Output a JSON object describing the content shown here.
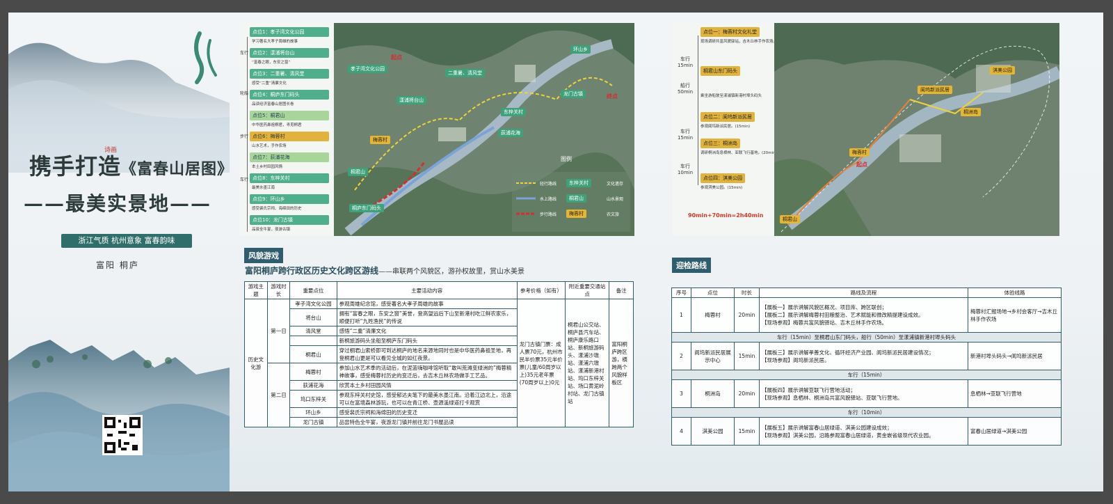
{
  "left": {
    "title_a": "携手打造",
    "title_b": "《富春山居图》",
    "poet_tag": "诗画",
    "title_line2": "——最美实景地——",
    "slogan": "浙江气质  杭州意象  富春韵味",
    "location": "富阳  桐庐"
  },
  "map1": {
    "points": [
      {
        "label": "点位1：孝子湾文化公园",
        "desc": "学习著名大孝子周雄的故事",
        "style": "green"
      },
      {
        "label": "点位2：漾浦将台山",
        "desc": "“富春之眼，东安之窗”",
        "style": "green"
      },
      {
        "label": "点位3：二重暑、清风堂",
        "desc": "感受“二重”清廉文化",
        "style": "green"
      },
      {
        "label": "点位4：桐庐东门码头",
        "desc": "品读经济富春山居图长卷",
        "style": "green"
      },
      {
        "label": "点位5：桐君山",
        "desc": "中华医药鼻祖桐君，寻觅桐君",
        "style": "light"
      },
      {
        "label": "点位6：梅蓉村",
        "desc": "山水艺术，手作农场",
        "style": "yellow"
      },
      {
        "label": "点位7：荻浦花海",
        "desc": "本土乡村田园风情",
        "style": "light"
      },
      {
        "label": "点位8：东梓关村",
        "desc": "最美水墨江南",
        "style": "green"
      },
      {
        "label": "点位9：环山乡",
        "desc": "感受裴氏宗祠、海绵田的历史",
        "style": "green"
      },
      {
        "label": "点位10：龙门古镇",
        "desc": "品尝全牛宴，夜游古镇",
        "style": "green"
      }
    ],
    "modes": [
      "车行",
      "轮船",
      "步行",
      "车行"
    ],
    "map_labels": {
      "start": "起点",
      "end": "终点",
      "legend": "图例",
      "l1": "孝子湾文化公园",
      "l2": "二重暑、清风堂",
      "l3": "环山乡",
      "l4": "漾浦将台山",
      "l5": "龙门古镇",
      "l6": "东梓关村",
      "l7": "荻浦花海",
      "l8": "梅蓉村",
      "l9": "桐君山",
      "l10": "桐庐东门码头"
    },
    "legend": [
      {
        "line": "轻行路线",
        "tag": "东梓关村",
        "tag_desc": "文化遗存"
      },
      {
        "line": "水上路线",
        "tag": "桐君山",
        "tag_desc": "山水景观"
      },
      {
        "line": "步行路线",
        "tag": "梅蓉村",
        "tag_desc": "农文旅"
      }
    ]
  },
  "map2": {
    "points": [
      {
        "mode": "",
        "label": "点位一：梅蓉村文化礼堂",
        "desc": "现场调研共富风貌驿站，吉木丘林手作农场。(20min)"
      },
      {
        "mode": "车行15min",
        "label": "桐君山东门码头",
        "desc": ""
      },
      {
        "mode": "船行50min",
        "label": "",
        "desc": "乘坐游船驶至漾浦镇新港村埠头码头"
      },
      {
        "mode": "",
        "label": "点位二：阆坞新派民居",
        "desc": "参观阆坞新派民居。(15min)"
      },
      {
        "mode": "车行15min",
        "label": "点位三：桐洲岛",
        "desc": "调研桐洲岛息栖林、亚联飞行基地。(20min)"
      },
      {
        "mode": "车行10min",
        "label": "点位四：淇美公园",
        "desc": "参观淇美公园。(15min)"
      }
    ],
    "total": "90min+70min=2h40min",
    "map_labels": {
      "l1": "淇美公园",
      "l2": "阆坞新派民居",
      "l3": "桐洲岛",
      "l4": "梅蓉村",
      "l5": "桐君山",
      "start": "起点"
    }
  },
  "section1": {
    "tag": "风貌游戏",
    "subtitle": "富阳桐庐跨行政区历史文化跨区游线",
    "subtitle_tail": "——串联两个风貌区，游孙权故里，赏山水美景",
    "headers": [
      "游戏主题",
      "游戏时长",
      "重要点位",
      "主要活动内容",
      "参考价格（如有）",
      "附近重要交通站点",
      "备注"
    ],
    "theme": "历史文化游",
    "day1": "第一日",
    "day2": "第二日",
    "rows": [
      {
        "point": "孝子湾文化公园",
        "activity": "参观周雄纪念馆，感受著名大孝子周雄的故事"
      },
      {
        "point": "将台山",
        "activity": "拥有“富春之眼，东安之窗”美誉，登高望远后下山至新港村吃江鲜农家乐，顺便打听“九姓渔民”的传说"
      },
      {
        "point": "清风堂",
        "activity": "感悟“二重”清廉文化"
      },
      {
        "point": "",
        "activity": "新桐旅游码头坐船至桐庐东门码头"
      },
      {
        "point": "桐君山",
        "activity": "穿过桐君山索桥即可到达桐庐的地名来源地同时也是中华医药鼻祖圣地，再登桐君山更是可以看见全城的如红夜景。"
      },
      {
        "point": "梅蓉村",
        "activity": "参加山水艺术季的活动后，在泥蓝嗨咖啡馆听取“敢叫荒滩变绿洲的”梅蓉精神故事，感受梅蓉村历史的变迁后，去吉木丘林农场做手工艺品。"
      },
      {
        "point": "荻浦花海",
        "activity": "欣赏本土乡村田园风情"
      },
      {
        "point": "坞口东梓关",
        "activity": "参观东梓关村史馆，感受郁达夫笔下的最美水墨江南。沿着江边北上，沿途可以在富境森林游玩，也可以在青江桥、壶源溪绿道打卡观赏"
      },
      {
        "point": "环山乡",
        "activity": "感受裴氏宗祠和海绵田的历史变迁"
      },
      {
        "point": "龙门古镇",
        "activity": "品尝特色全牛宴，夜游龙门镇并前往龙门书屋品读"
      }
    ],
    "price": "龙门古镇门票：成人票70元，杭州市民半价票35元半价票(儿童/60周岁以上)35元老年票(70周岁以上)0元",
    "stations": "桐君山公交站、桐庐县汽车站、桐庐康乐路口站、新桐旅游码头、漾浦沙墩站、漾浦六墩站、漾浦新港村站、坞口东梓关站、场口黄泥岭村站、龙门古镇站",
    "note": "富阳桐庐跨区游，横跨两个风貌样板区"
  },
  "section2": {
    "tag": "迎检路线",
    "headers": [
      "序号",
      "点位",
      "时长",
      "路线及流程",
      "体验线路"
    ],
    "rows": [
      {
        "no": "1",
        "point": "梅蓉村",
        "dur": "20min",
        "flow": "【展板一】展示讲解风貌区概况、项目库、跨区联创；\n【展板二】展示讲解梅蓉村田粮整治、艺术赋能和微改精提建设成效。\n【现场参观】梅蓉共富风貌驿站、吉木丘林手作农场。",
        "exp": "梅蓉村汇报场地→乡村会客厅→吉木丘林手作农场"
      },
      {
        "no": "2",
        "point": "阆坞新派民居展示中心",
        "dur": "15min",
        "flow": "【展板三】展示讲解孝善文化、循环经济产业园、阆坞新派民居建设情况；\n【现场参观】阆坞新派民居。",
        "exp": "新港村埠头码头→阆坞新派民居"
      },
      {
        "no": "3",
        "point": "桐洲岛",
        "dur": "20min",
        "flow": "【展板四】展示讲解亚联飞行营地活动；\n【现场参观】息栖林、桐洲岛共富风貌驿站、亚联飞行营地。",
        "exp": "息栖林→亚联飞行营地"
      },
      {
        "no": "4",
        "point": "淇美公园",
        "dur": "15min",
        "flow": "【展板五】展示讲解富春山居绿道、淇美公园建设成效；\n【现场参观】淇美公园，沿路参观富春山居绿道，黄金嵌省级现代农业园。",
        "exp": "富春山居绿道→淇美公园"
      }
    ],
    "bars": [
      "车行（15min）至桐君山东门码头，船行（50min）至漾浦镇新港村埠头码头",
      "车行（15min）",
      "车行（10min）"
    ]
  }
}
